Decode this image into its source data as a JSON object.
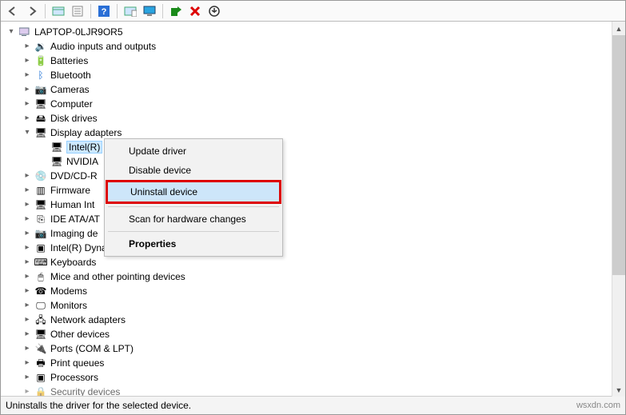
{
  "toolbar": {
    "back": "←",
    "forward": "→"
  },
  "tree": {
    "root": "LAPTOP-0LJR9OR5",
    "categories": [
      "Audio inputs and outputs",
      "Batteries",
      "Bluetooth",
      "Cameras",
      "Computer",
      "Disk drives",
      "Display adapters",
      "DVD/CD-R",
      "Firmware",
      "Human Int",
      "IDE ATA/AT",
      "Imaging de",
      "Intel(R) Dynamic Platform and Thermal Framework",
      "Keyboards",
      "Mice and other pointing devices",
      "Modems",
      "Monitors",
      "Network adapters",
      "Other devices",
      "Ports (COM & LPT)",
      "Print queues",
      "Processors",
      "Security devices"
    ],
    "display_children": {
      "intel": "Intel(R)",
      "nvidia": "NVIDIA"
    }
  },
  "context_menu": {
    "update": "Update driver",
    "disable": "Disable device",
    "uninstall": "Uninstall device",
    "scan": "Scan for hardware changes",
    "properties": "Properties"
  },
  "statusbar": {
    "text": "Uninstalls the driver for the selected device.",
    "watermark": "wsxdn.com"
  }
}
